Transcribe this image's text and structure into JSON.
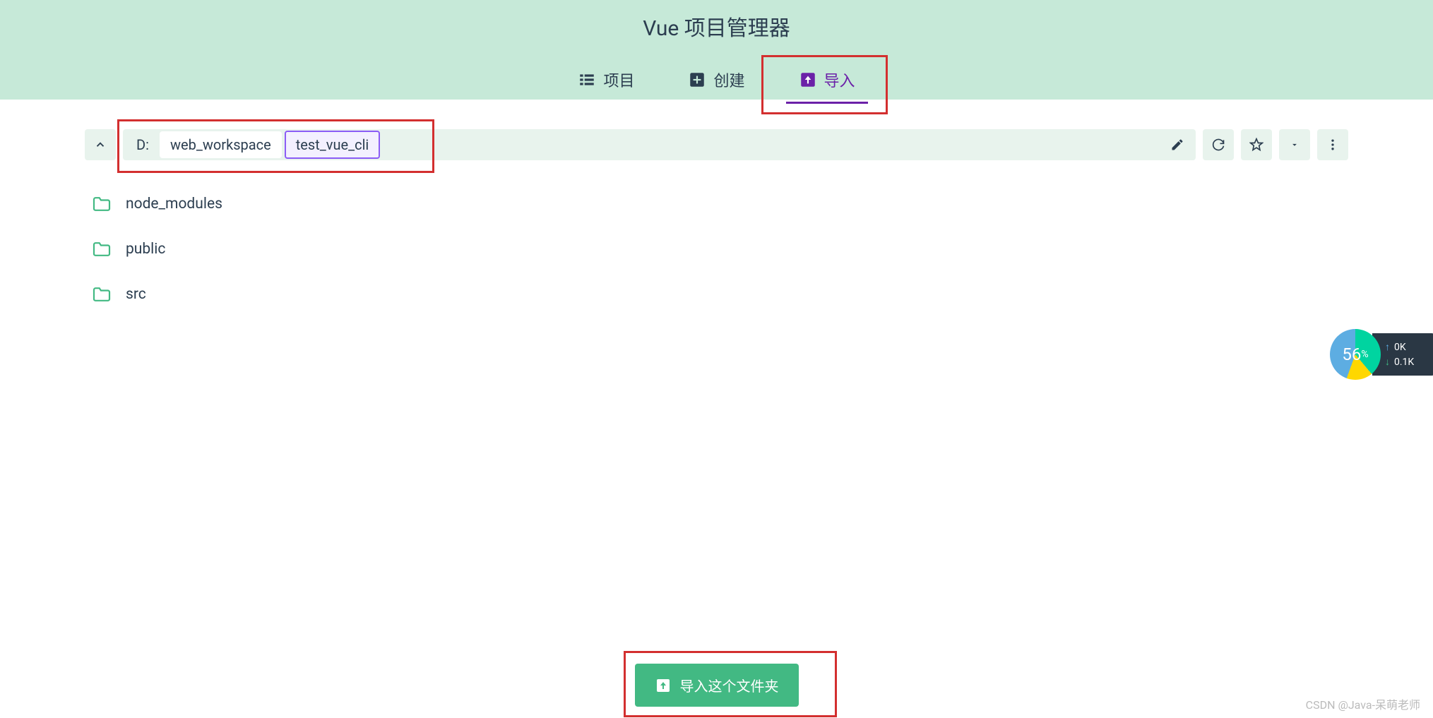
{
  "header": {
    "title": "Vue 项目管理器"
  },
  "tabs": {
    "projects": "项目",
    "create": "创建",
    "import": "导入"
  },
  "path": {
    "drive": "D:",
    "seg1": "web_workspace",
    "seg2": "test_vue_cli"
  },
  "files": {
    "items": [
      {
        "name": "node_modules"
      },
      {
        "name": "public"
      },
      {
        "name": "src"
      }
    ]
  },
  "import_button": "导入这个文件夹",
  "watermark": "CSDN @Java-呆萌老师",
  "widget": {
    "percent": "56",
    "percent_suffix": "%",
    "up": "0K",
    "down": "0.1K"
  }
}
